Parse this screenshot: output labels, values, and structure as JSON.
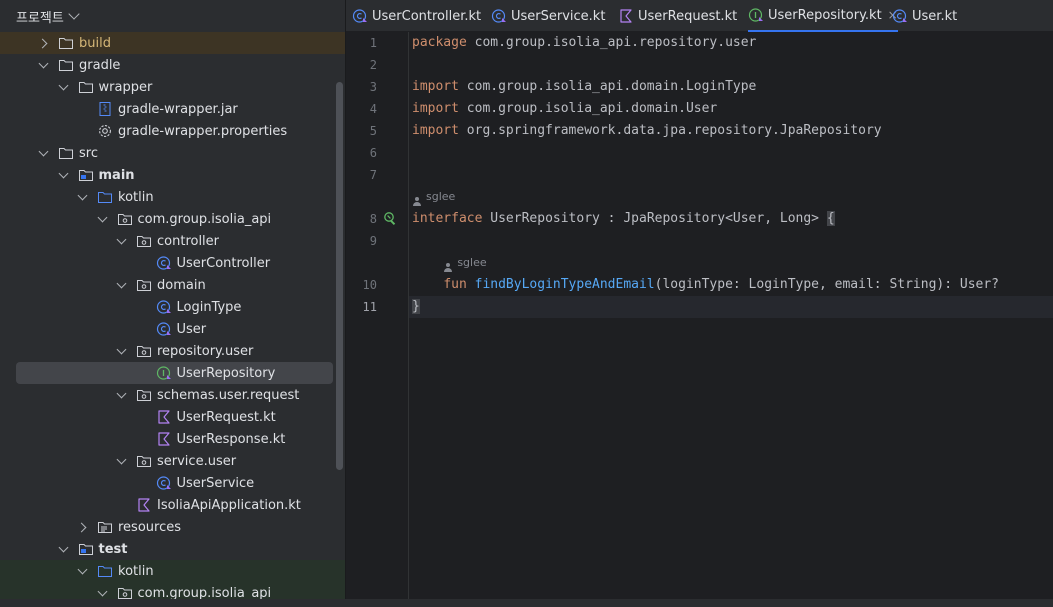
{
  "project_panel": {
    "title": "프로젝트",
    "tree": [
      {
        "label": "build",
        "icon": "folder-icon",
        "arrow": "right",
        "indent": 0,
        "style": "build"
      },
      {
        "label": "gradle",
        "icon": "folder-icon",
        "arrow": "down",
        "indent": 0
      },
      {
        "label": "wrapper",
        "icon": "folder-icon",
        "arrow": "down",
        "indent": 1
      },
      {
        "label": "gradle-wrapper.jar",
        "icon": "jar-file-icon",
        "arrow": "none",
        "indent": 2
      },
      {
        "label": "gradle-wrapper.properties",
        "icon": "settings-file-icon",
        "arrow": "none",
        "indent": 2
      },
      {
        "label": "src",
        "icon": "folder-icon",
        "arrow": "down",
        "indent": 0
      },
      {
        "label": "main",
        "icon": "module-folder-icon",
        "arrow": "down",
        "indent": 1,
        "bold": true
      },
      {
        "label": "kotlin",
        "icon": "source-folder-icon",
        "arrow": "down",
        "indent": 2
      },
      {
        "label": "com.group.isolia_api",
        "icon": "package-icon",
        "arrow": "down",
        "indent": 3
      },
      {
        "label": "controller",
        "icon": "package-icon",
        "arrow": "down",
        "indent": 4
      },
      {
        "label": "UserController",
        "icon": "kotlin-class-icon",
        "arrow": "none",
        "indent": 5
      },
      {
        "label": "domain",
        "icon": "package-icon",
        "arrow": "down",
        "indent": 4
      },
      {
        "label": "LoginType",
        "icon": "kotlin-class-icon",
        "arrow": "none",
        "indent": 5
      },
      {
        "label": "User",
        "icon": "kotlin-class-icon",
        "arrow": "none",
        "indent": 5
      },
      {
        "label": "repository.user",
        "icon": "package-icon",
        "arrow": "down",
        "indent": 4
      },
      {
        "label": "UserRepository",
        "icon": "kotlin-interface-icon",
        "arrow": "none",
        "indent": 5,
        "selected": true
      },
      {
        "label": "schemas.user.request",
        "icon": "package-icon",
        "arrow": "down",
        "indent": 4
      },
      {
        "label": "UserRequest.kt",
        "icon": "kotlin-file-icon",
        "arrow": "none",
        "indent": 5
      },
      {
        "label": "UserResponse.kt",
        "icon": "kotlin-file-icon",
        "arrow": "none",
        "indent": 5
      },
      {
        "label": "service.user",
        "icon": "package-icon",
        "arrow": "down",
        "indent": 4
      },
      {
        "label": "UserService",
        "icon": "kotlin-class-icon",
        "arrow": "none",
        "indent": 5
      },
      {
        "label": "IsoliaApiApplication.kt",
        "icon": "kotlin-file-icon",
        "arrow": "none",
        "indent": 4
      },
      {
        "label": "resources",
        "icon": "resources-folder-icon",
        "arrow": "right",
        "indent": 2
      },
      {
        "label": "test",
        "icon": "module-folder-icon",
        "arrow": "down",
        "indent": 1,
        "bold": true
      },
      {
        "label": "kotlin",
        "icon": "source-folder-icon",
        "arrow": "down",
        "indent": 2,
        "style": "green"
      },
      {
        "label": "com.group.isolia_api",
        "icon": "package-icon",
        "arrow": "down",
        "indent": 3,
        "style": "green"
      }
    ]
  },
  "tabs": [
    {
      "label": "UserController.kt",
      "icon": "kotlin-class-icon"
    },
    {
      "label": "UserService.kt",
      "icon": "kotlin-class-icon"
    },
    {
      "label": "UserRequest.kt",
      "icon": "kotlin-file-icon"
    },
    {
      "label": "UserRepository.kt",
      "icon": "kotlin-interface-icon",
      "active": true,
      "close": "×"
    },
    {
      "label": "User.kt",
      "icon": "kotlin-class-icon"
    }
  ],
  "editor": {
    "current_line": "11",
    "lines": [
      {
        "n": "1",
        "tokens": [
          [
            "kw",
            "package"
          ],
          [
            "",
            " com.group.isolia_api.repository.user"
          ]
        ]
      },
      {
        "n": "2",
        "tokens": []
      },
      {
        "n": "3",
        "tokens": [
          [
            "kw",
            "import"
          ],
          [
            "",
            " com.group.isolia_api.domain.LoginType"
          ]
        ]
      },
      {
        "n": "4",
        "tokens": [
          [
            "kw",
            "import"
          ],
          [
            "",
            " com.group.isolia_api.domain.User"
          ]
        ]
      },
      {
        "n": "5",
        "tokens": [
          [
            "kw",
            "import"
          ],
          [
            "",
            " org.springframework.data.jpa.repository.JpaRepository"
          ]
        ]
      },
      {
        "n": "6",
        "tokens": []
      },
      {
        "n": "7",
        "tokens": []
      },
      {
        "inlay": "sglee"
      },
      {
        "n": "8",
        "gutter_icon": "implemented-icon",
        "tokens": [
          [
            "kw",
            "interface"
          ],
          [
            "",
            " UserRepository : JpaRepository<User, Long> "
          ],
          [
            "brace",
            "{"
          ]
        ]
      },
      {
        "n": "9",
        "tokens": []
      },
      {
        "inlay": "sglee",
        "indent": "    "
      },
      {
        "n": "10",
        "tokens": [
          [
            "",
            "    "
          ],
          [
            "kw",
            "fun"
          ],
          [
            "",
            " "
          ],
          [
            "fn",
            "findByLoginTypeAndEmail"
          ],
          [
            "",
            "(loginType: LoginType, email: String): User?"
          ]
        ]
      },
      {
        "n": "11",
        "tokens": [
          [
            "brace",
            "}"
          ]
        ]
      }
    ]
  },
  "colors": {
    "keyword": "#cf8e6d",
    "function": "#56a8f5",
    "text": "#bcbec4",
    "accent": "#3574f0"
  }
}
